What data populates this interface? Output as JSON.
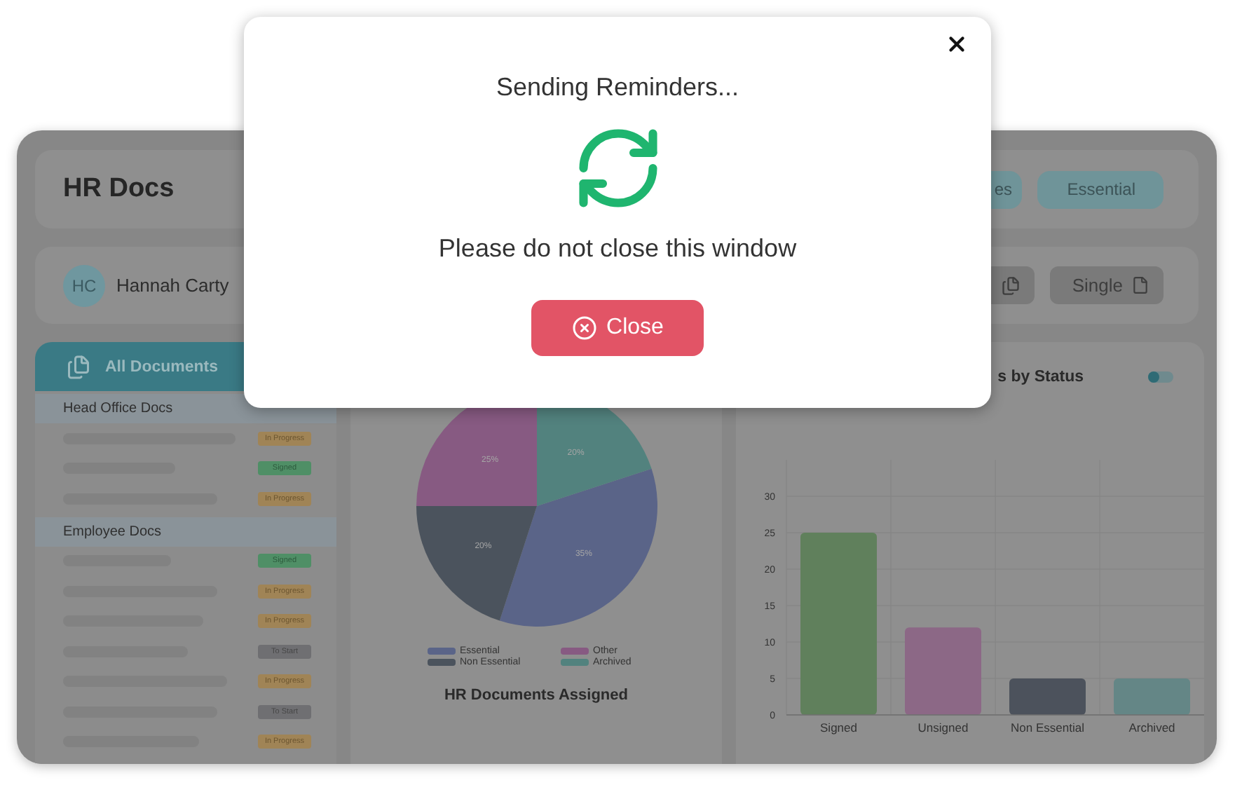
{
  "dashboard": {
    "header": {
      "title": "HR Docs",
      "filters": [
        {
          "label": "es",
          "selected": true
        },
        {
          "label": "Essential",
          "selected": true
        }
      ]
    },
    "user": {
      "initials": "HC",
      "name": "Hannah Carty",
      "send_modes": [
        {
          "kind": "multiple"
        },
        {
          "kind": "single",
          "label": "Single"
        }
      ]
    },
    "documents": {
      "title": "All Documents",
      "groups": [
        {
          "name": "Head Office Docs",
          "rows": [
            {
              "kind": "in_progress",
              "status": "In Progress"
            },
            {
              "kind": "signed",
              "status": "Signed"
            },
            {
              "kind": "in_progress",
              "status": "In Progress"
            }
          ]
        },
        {
          "name": "Employee Docs",
          "rows": [
            {
              "kind": "signed",
              "status": "Signed"
            },
            {
              "kind": "in_progress",
              "status": "In Progress"
            },
            {
              "kind": "in_progress",
              "status": "In Progress"
            },
            {
              "kind": "to_start",
              "status": "To Start"
            },
            {
              "kind": "in_progress",
              "status": "In Progress"
            },
            {
              "kind": "to_start",
              "status": "To Start"
            },
            {
              "kind": "in_progress",
              "status": "In Progress"
            }
          ]
        }
      ]
    },
    "type_chart": {
      "chart_data": {
        "type": "pie",
        "categories": [
          "Essential",
          "Non Essential",
          "Other",
          "Archived"
        ],
        "values": [
          35,
          20,
          25,
          20
        ],
        "colors": [
          "#5a6488",
          "#4b535d",
          "#875a82",
          "#52827e"
        ],
        "value_labels": [
          "35%",
          "20%",
          "25%",
          "20%"
        ]
      },
      "caption": "HR Documents Assigned"
    },
    "status_chart": {
      "title": "s by Status",
      "toggle": {
        "on": false
      },
      "chart_data": {
        "type": "bar",
        "categories": [
          "Signed",
          "Unsigned",
          "Non Essential",
          "Archived"
        ],
        "grid": true,
        "ylim": [
          0,
          35
        ],
        "yticks": [
          0,
          5,
          10,
          15,
          20,
          25,
          30
        ],
        "values": [
          25,
          12,
          5,
          5
        ],
        "colors": [
          "#60805c",
          "#8c6886",
          "#4c525c",
          "#648686"
        ]
      }
    }
  },
  "modal": {
    "title": "Sending Reminders...",
    "message": "Please do not close this window",
    "close_button": "Close"
  }
}
